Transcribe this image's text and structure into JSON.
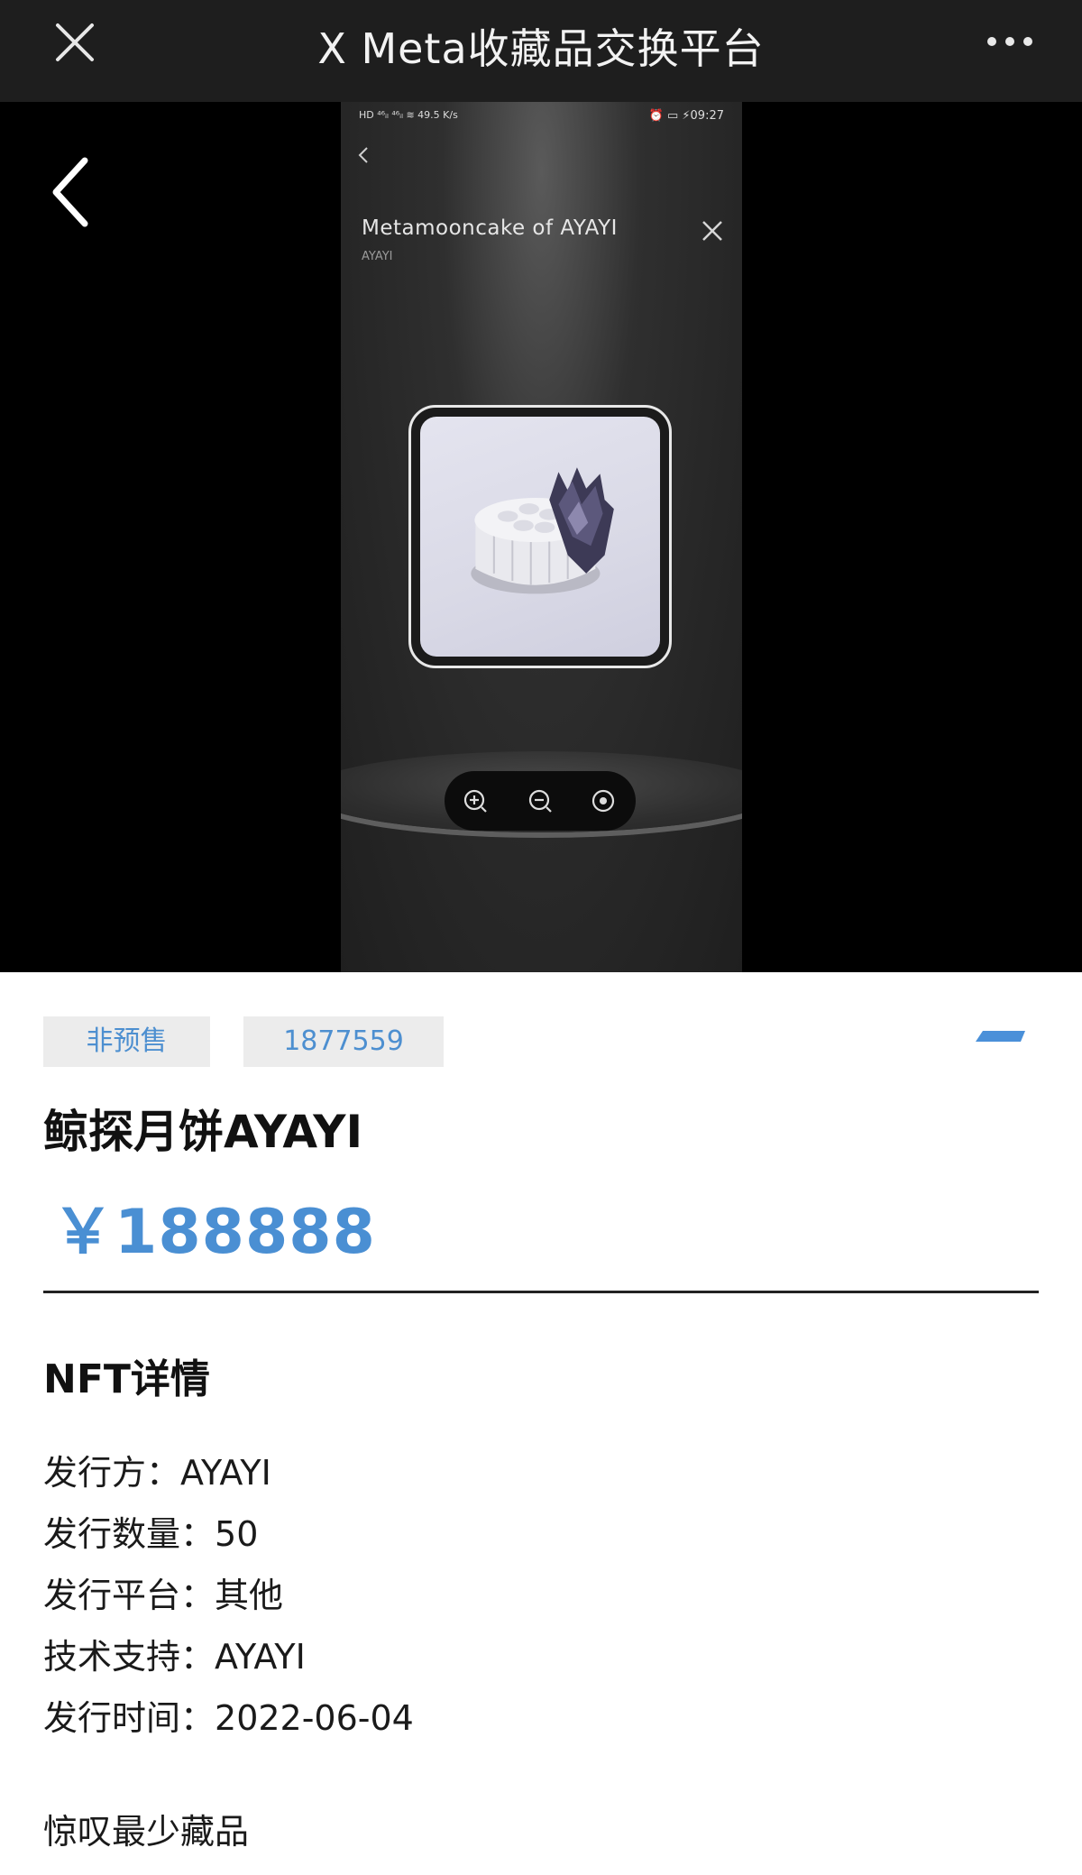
{
  "header": {
    "title": "X Meta收藏品交换平台",
    "close_icon": "close-icon",
    "more_icon": "more-dots-icon"
  },
  "viewer": {
    "back_icon": "chevron-left-icon",
    "status_bar": {
      "left": "HD ⁴⁶ᵢₗ ⁴⁶ᵢₗ ≋ 49.5 K/s",
      "right": "⏰ ▭ ⚡09:27"
    },
    "piece_title": "Metamooncake of AYAYI",
    "piece_subtitle": "AYAYI",
    "zoom_controls": [
      "zoom-in-icon",
      "zoom-out-icon",
      "reset-view-icon"
    ]
  },
  "product": {
    "tags": [
      "非预售",
      "1877559"
    ],
    "name": "鲸探月饼AYAYI",
    "price": "￥188888",
    "accent_color": "#4a8fd3"
  },
  "details": {
    "title": "NFT详情",
    "rows": [
      {
        "label": "发行方：",
        "value": "AYAYI"
      },
      {
        "label": "发行数量：",
        "value": "50"
      },
      {
        "label": "发行平台：",
        "value": "其他"
      },
      {
        "label": "技术支持：",
        "value": "AYAYI"
      },
      {
        "label": "发行时间：",
        "value": "2022-06-04"
      }
    ],
    "description": "惊叹最少藏品"
  }
}
